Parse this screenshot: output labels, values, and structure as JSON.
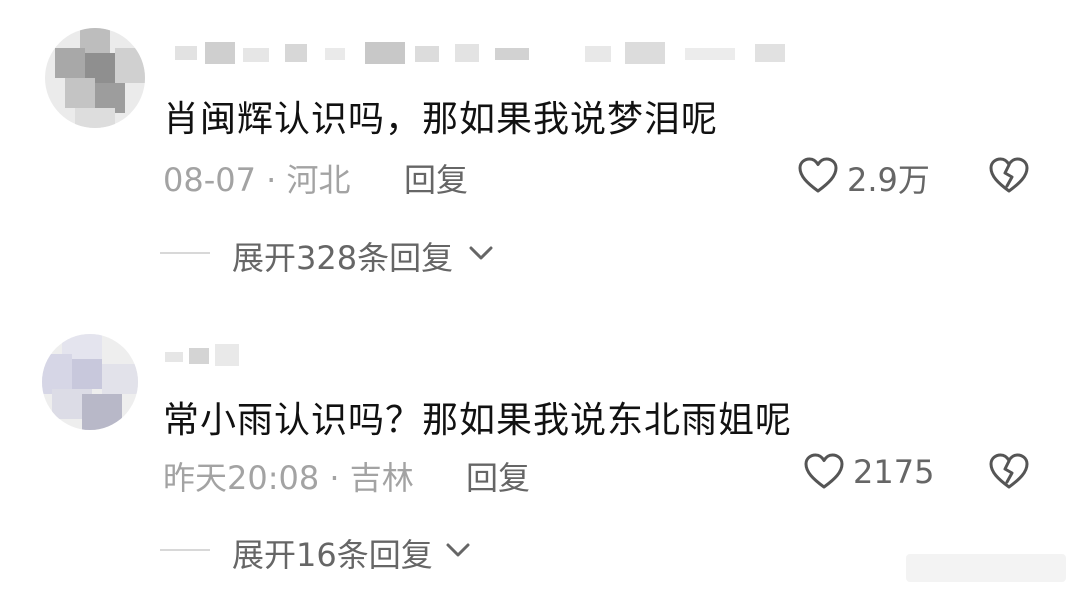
{
  "comments": [
    {
      "text": "肖闽辉认识吗，那如果我说梦泪呢",
      "meta": "08-07 · 河北",
      "reply_label": "回复",
      "likes": "2.9万",
      "expand_label": "展开328条回复"
    },
    {
      "text": "常小雨认识吗？那如果我说东北雨姐呢",
      "meta": "昨天20:08 · 吉林",
      "reply_label": "回复",
      "likes": "2175",
      "expand_label": "展开16条回复"
    }
  ],
  "icons": {
    "like": "heart-outline-icon",
    "dislike": "broken-heart-icon",
    "expand": "chevron-down-icon"
  },
  "colors": {
    "primary_text": "#111111",
    "secondary_text": "#666666",
    "meta_text": "#a3a3a3",
    "divider": "#d8d8d8"
  }
}
